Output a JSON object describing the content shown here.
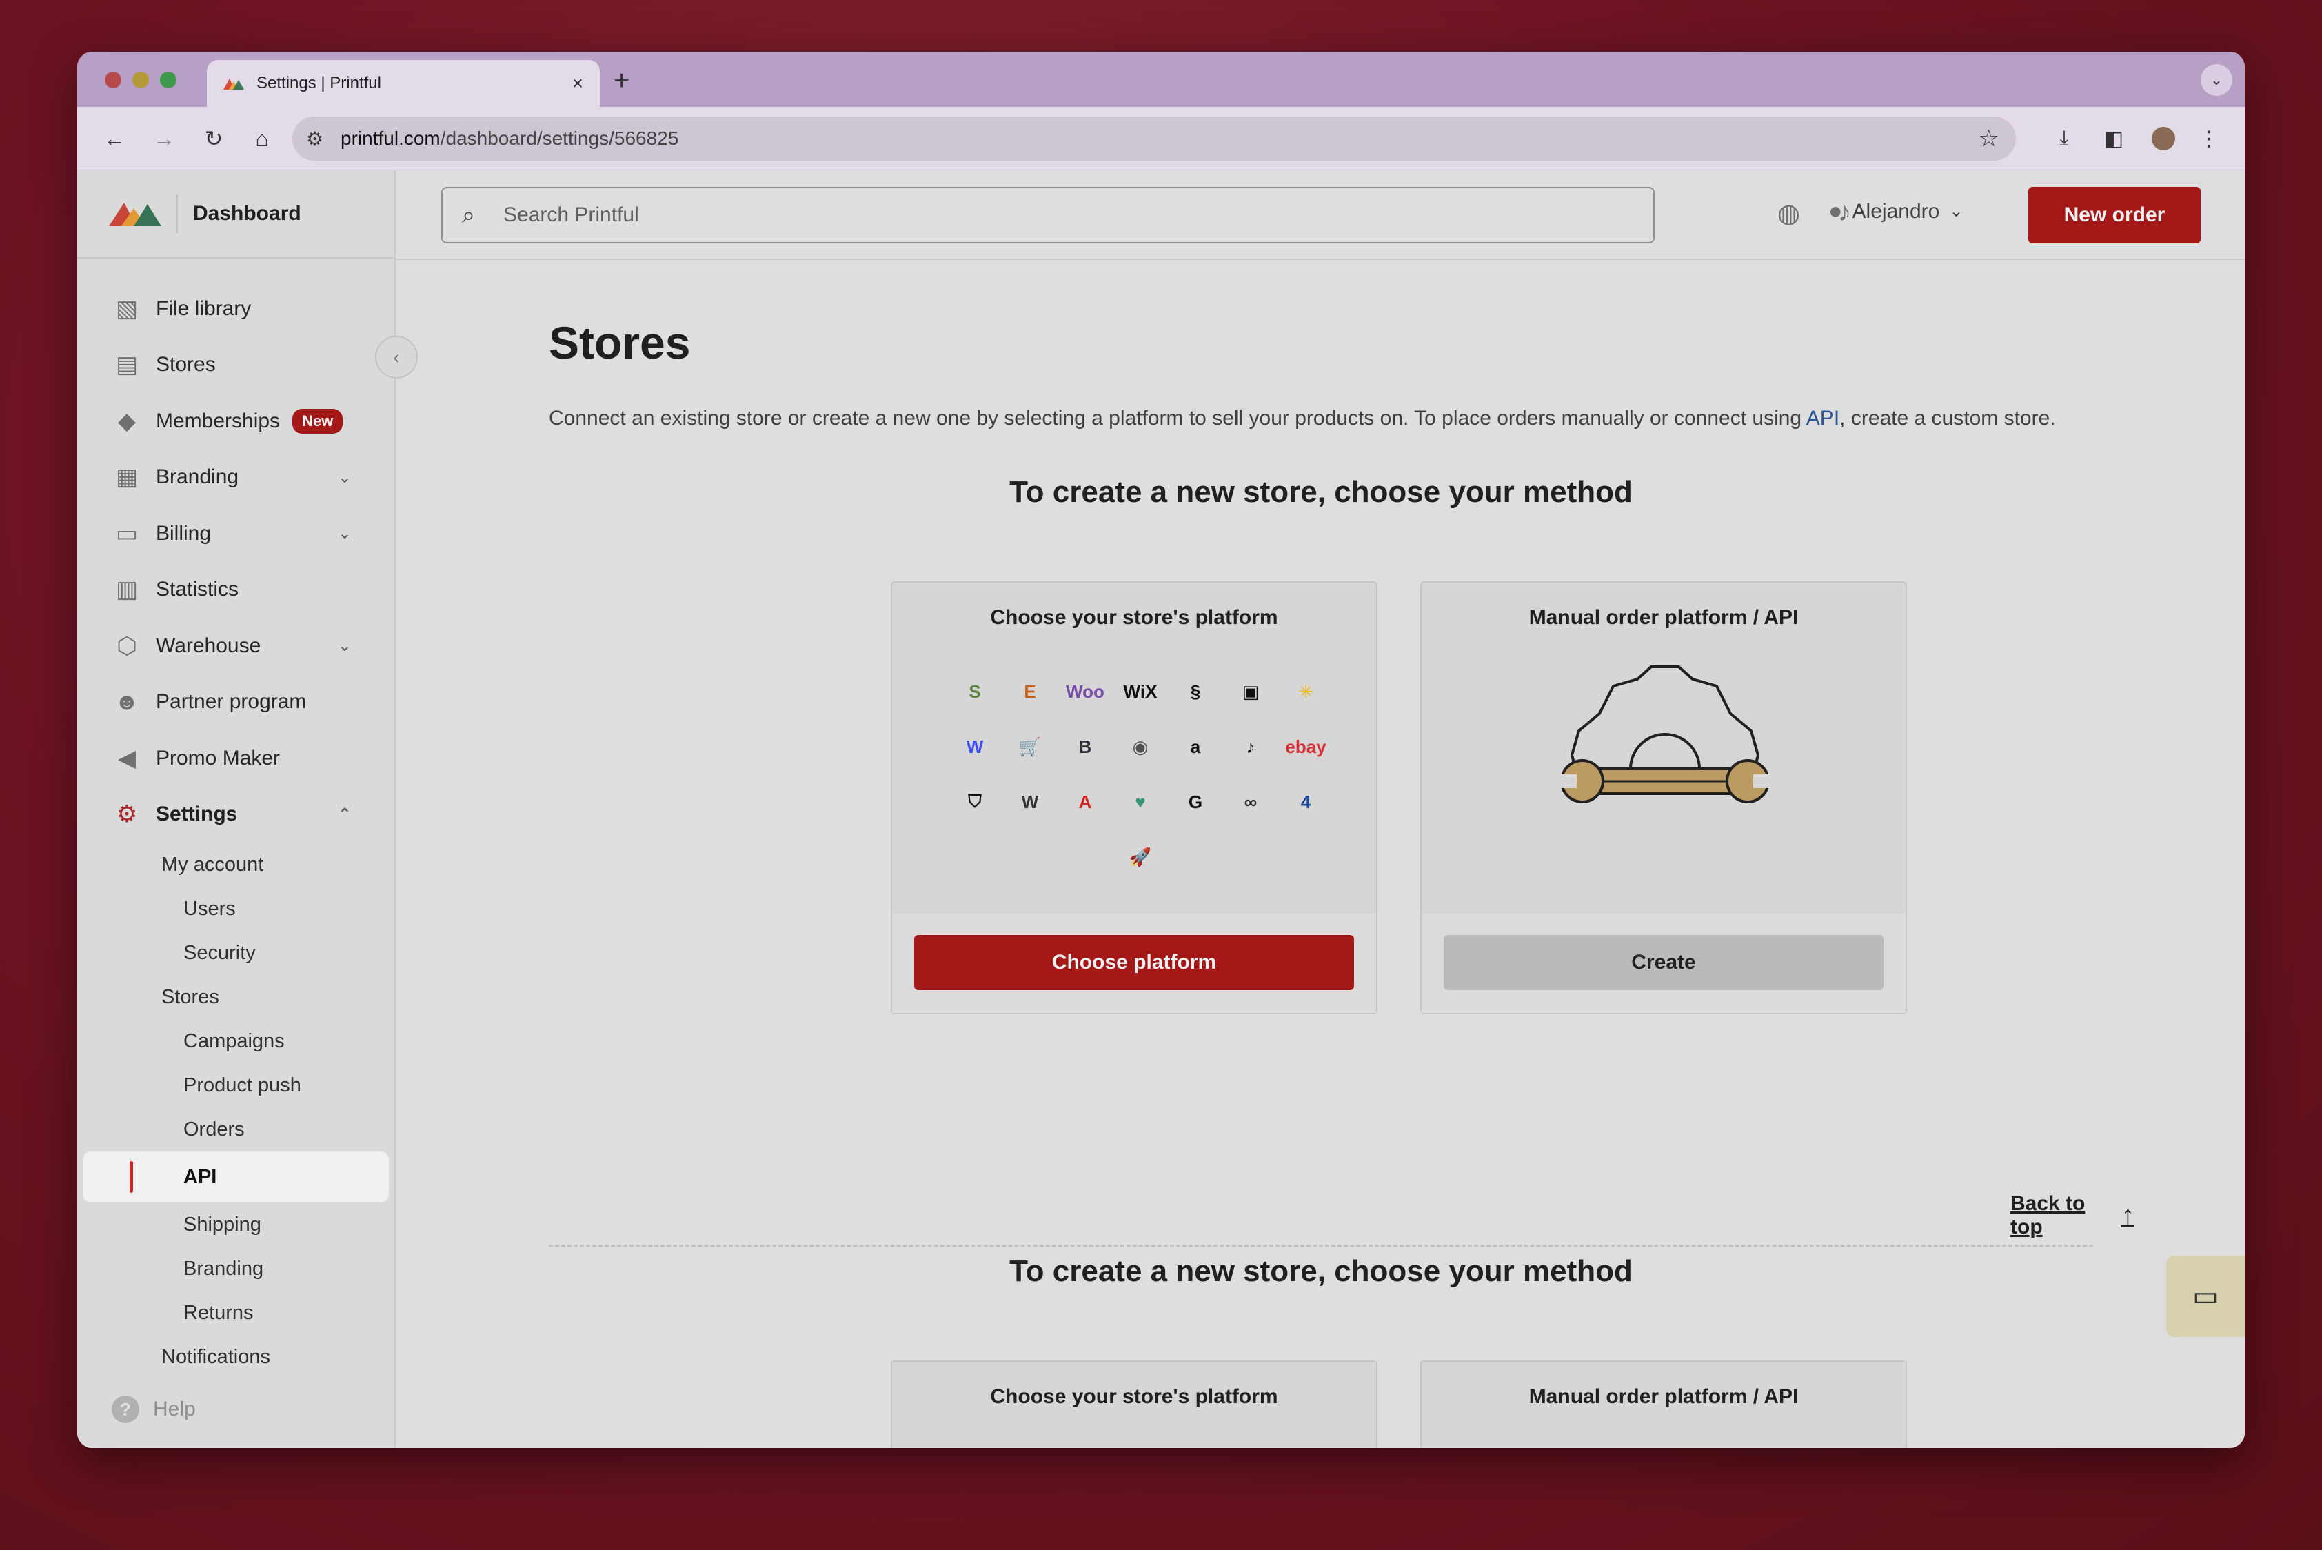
{
  "browser": {
    "tab_title": "Settings | Printful",
    "url_host": "printful.com",
    "url_path": "/dashboard/settings/566825"
  },
  "header": {
    "brand": "Dashboard",
    "search_placeholder": "Search Printful",
    "user_name": "Alejandro",
    "new_order_label": "New order"
  },
  "sidebar": {
    "items": [
      {
        "label": "File library",
        "icon": "image-icon"
      },
      {
        "label": "Stores",
        "icon": "store-icon"
      },
      {
        "label": "Memberships",
        "icon": "membership-icon",
        "badge": "New"
      },
      {
        "label": "Branding",
        "icon": "branding-icon"
      },
      {
        "label": "Billing",
        "icon": "card-icon"
      },
      {
        "label": "Statistics",
        "icon": "bar-chart-icon"
      },
      {
        "label": "Warehouse",
        "icon": "box-icon"
      },
      {
        "label": "Partner program",
        "icon": "people-icon"
      },
      {
        "label": "Promo Maker",
        "icon": "megaphone-icon"
      },
      {
        "label": "Settings",
        "icon": "gear-icon"
      }
    ],
    "settings_sub": {
      "my_account": "My account",
      "users": "Users",
      "security": "Security",
      "stores": "Stores",
      "campaigns": "Campaigns",
      "product_push": "Product push",
      "orders": "Orders",
      "api": "API",
      "shipping": "Shipping",
      "branding": "Branding",
      "returns": "Returns",
      "notifications": "Notifications"
    },
    "help": "Help"
  },
  "main": {
    "title": "Stores",
    "intro_before": "Connect an existing store or create a new one by selecting a platform to sell your products on. To place orders manually or connect using ",
    "intro_link": "API",
    "intro_after": ", create a custom store.",
    "method_heading": "To create a new store, choose your method",
    "card_platform_title": "Choose your store's platform",
    "card_platform_button": "Choose platform",
    "card_manual_title": "Manual order platform / API",
    "card_manual_button": "Create",
    "back_to_top": "Back to top",
    "platform_logos": [
      {
        "name": "shopify",
        "text": "S",
        "color": "#5e8e3e"
      },
      {
        "name": "etsy",
        "text": "E",
        "color": "#d5641c"
      },
      {
        "name": "woocommerce",
        "text": "Woo",
        "color": "#7f54b3"
      },
      {
        "name": "wix",
        "text": "WiX",
        "color": "#111111"
      },
      {
        "name": "squarespace",
        "text": "§",
        "color": "#111111"
      },
      {
        "name": "square",
        "text": "▣",
        "color": "#111111"
      },
      {
        "name": "walmart",
        "text": "✳",
        "color": "#ffc220"
      },
      {
        "name": "webflow",
        "text": "W",
        "color": "#4353ff"
      },
      {
        "name": "shipstation",
        "text": "🛒",
        "color": "#111111"
      },
      {
        "name": "bigcommerce",
        "text": "B",
        "color": "#34313f"
      },
      {
        "name": "storenvy",
        "text": "◉",
        "color": "#555555"
      },
      {
        "name": "amazon",
        "text": "a",
        "color": "#111111"
      },
      {
        "name": "tiktok",
        "text": "♪",
        "color": "#111111"
      },
      {
        "name": "ebay",
        "text": "ebay",
        "color": "#e53238"
      },
      {
        "name": "shield",
        "text": "⛉",
        "color": "#111111"
      },
      {
        "name": "weebly",
        "text": "W",
        "color": "#333333"
      },
      {
        "name": "adobe",
        "text": "A",
        "color": "#e1251b"
      },
      {
        "name": "heart",
        "text": "♥",
        "color": "#3aa17e"
      },
      {
        "name": "gumroad",
        "text": "G",
        "color": "#111111"
      },
      {
        "name": "links",
        "text": "∞",
        "color": "#333333"
      },
      {
        "name": "four",
        "text": "4",
        "color": "#1f4fa8"
      },
      {
        "name": "shoprocket",
        "text": "🚀",
        "color": "#e48a2a"
      }
    ]
  }
}
